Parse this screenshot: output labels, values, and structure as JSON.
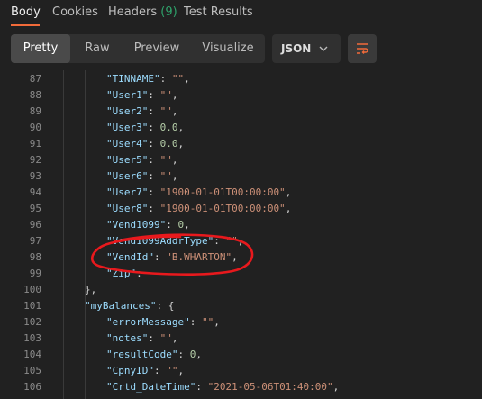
{
  "tabs": {
    "body": "Body",
    "cookies": "Cookies",
    "headers": "Headers",
    "headers_count": "(9)",
    "test_results": "Test Results"
  },
  "toolbar": {
    "pretty": "Pretty",
    "raw": "Raw",
    "preview": "Preview",
    "visualize": "Visualize",
    "format": "JSON"
  },
  "colors": {
    "accent": "#f26b3a",
    "key": "#9cdcfe",
    "string": "#ce9178",
    "number": "#b5cea8",
    "annotation": "#e8191d"
  },
  "lines": [
    {
      "num": "87",
      "indent": 4,
      "tokens": [
        [
          "k",
          "\"TINNAME\""
        ],
        [
          "p",
          ": "
        ],
        [
          "s",
          "\"\""
        ],
        [
          "p",
          ","
        ]
      ]
    },
    {
      "num": "88",
      "indent": 4,
      "tokens": [
        [
          "k",
          "\"User1\""
        ],
        [
          "p",
          ": "
        ],
        [
          "s",
          "\"\""
        ],
        [
          "p",
          ","
        ]
      ]
    },
    {
      "num": "89",
      "indent": 4,
      "tokens": [
        [
          "k",
          "\"User2\""
        ],
        [
          "p",
          ": "
        ],
        [
          "s",
          "\"\""
        ],
        [
          "p",
          ","
        ]
      ]
    },
    {
      "num": "90",
      "indent": 4,
      "tokens": [
        [
          "k",
          "\"User3\""
        ],
        [
          "p",
          ": "
        ],
        [
          "n",
          "0.0"
        ],
        [
          "p",
          ","
        ]
      ]
    },
    {
      "num": "91",
      "indent": 4,
      "tokens": [
        [
          "k",
          "\"User4\""
        ],
        [
          "p",
          ": "
        ],
        [
          "n",
          "0.0"
        ],
        [
          "p",
          ","
        ]
      ]
    },
    {
      "num": "92",
      "indent": 4,
      "tokens": [
        [
          "k",
          "\"User5\""
        ],
        [
          "p",
          ": "
        ],
        [
          "s",
          "\"\""
        ],
        [
          "p",
          ","
        ]
      ]
    },
    {
      "num": "93",
      "indent": 4,
      "tokens": [
        [
          "k",
          "\"User6\""
        ],
        [
          "p",
          ": "
        ],
        [
          "s",
          "\"\""
        ],
        [
          "p",
          ","
        ]
      ]
    },
    {
      "num": "94",
      "indent": 4,
      "tokens": [
        [
          "k",
          "\"User7\""
        ],
        [
          "p",
          ": "
        ],
        [
          "s",
          "\"1900-01-01T00:00:00\""
        ],
        [
          "p",
          ","
        ]
      ]
    },
    {
      "num": "95",
      "indent": 4,
      "tokens": [
        [
          "k",
          "\"User8\""
        ],
        [
          "p",
          ": "
        ],
        [
          "s",
          "\"1900-01-01T00:00:00\""
        ],
        [
          "p",
          ","
        ]
      ]
    },
    {
      "num": "96",
      "indent": 4,
      "tokens": [
        [
          "k",
          "\"Vend1099\""
        ],
        [
          "p",
          ": "
        ],
        [
          "n",
          "0"
        ],
        [
          "p",
          ","
        ]
      ]
    },
    {
      "num": "97",
      "indent": 4,
      "tokens": [
        [
          "k",
          "\"Vend1099AddrType\""
        ],
        [
          "p",
          ": "
        ],
        [
          "s",
          "\"\""
        ],
        [
          "p",
          ","
        ]
      ]
    },
    {
      "num": "98",
      "indent": 4,
      "tokens": [
        [
          "k",
          "\"VendId\""
        ],
        [
          "p",
          ": "
        ],
        [
          "s",
          "\"B.WHARTON\""
        ],
        [
          "p",
          ","
        ]
      ]
    },
    {
      "num": "99",
      "indent": 4,
      "tokens": [
        [
          "k",
          "\"Zip\""
        ],
        [
          "p",
          ": "
        ]
      ]
    },
    {
      "num": "100",
      "indent": 2,
      "tokens": [
        [
          "p",
          "},"
        ]
      ]
    },
    {
      "num": "101",
      "indent": 2,
      "tokens": [
        [
          "k",
          "\"myBalances\""
        ],
        [
          "p",
          ": {"
        ]
      ]
    },
    {
      "num": "102",
      "indent": 4,
      "tokens": [
        [
          "k",
          "\"errorMessage\""
        ],
        [
          "p",
          ": "
        ],
        [
          "s",
          "\"\""
        ],
        [
          "p",
          ","
        ]
      ]
    },
    {
      "num": "103",
      "indent": 4,
      "tokens": [
        [
          "k",
          "\"notes\""
        ],
        [
          "p",
          ": "
        ],
        [
          "s",
          "\"\""
        ],
        [
          "p",
          ","
        ]
      ]
    },
    {
      "num": "104",
      "indent": 4,
      "tokens": [
        [
          "k",
          "\"resultCode\""
        ],
        [
          "p",
          ": "
        ],
        [
          "n",
          "0"
        ],
        [
          "p",
          ","
        ]
      ]
    },
    {
      "num": "105",
      "indent": 4,
      "tokens": [
        [
          "k",
          "\"CpnyID\""
        ],
        [
          "p",
          ": "
        ],
        [
          "s",
          "\"\""
        ],
        [
          "p",
          ","
        ]
      ]
    },
    {
      "num": "106",
      "indent": 4,
      "tokens": [
        [
          "k",
          "\"Crtd_DateTime\""
        ],
        [
          "p",
          ": "
        ],
        [
          "s",
          "\"2021-05-06T01:40:00\""
        ],
        [
          "p",
          ","
        ]
      ]
    }
  ]
}
